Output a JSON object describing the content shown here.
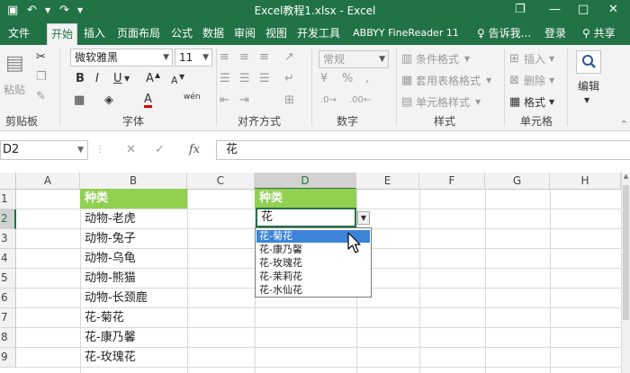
{
  "titlebar": {
    "title": "Excel教程1.xlsx - Excel",
    "undo_glyph": "↶",
    "redo_glyph": "↷",
    "save_glyph": "▣",
    "restore_glyph": "❐",
    "min_glyph": "—",
    "maximize_glyph": "□",
    "close_glyph": "✕"
  },
  "tabs": [
    {
      "label": "文件"
    },
    {
      "label": "开始",
      "active": true
    },
    {
      "label": "插入"
    },
    {
      "label": "页面布局"
    },
    {
      "label": "公式"
    },
    {
      "label": "数据"
    },
    {
      "label": "审阅"
    },
    {
      "label": "视图"
    },
    {
      "label": "开发工具"
    },
    {
      "label": "ABBYY FineReader 11"
    }
  ],
  "tell_me": "告诉我...",
  "login": "登录",
  "share": "共享",
  "ribbon": {
    "clipboard": {
      "paste": "粘贴",
      "label": "剪贴板"
    },
    "font": {
      "name": "微软雅黑",
      "size": "11",
      "bold": "B",
      "italic": "I",
      "underline": "U",
      "phonetic": "wén",
      "grow": "A",
      "shrink": "A",
      "font_color": "A",
      "label": "字体"
    },
    "alignment": {
      "label": "对齐方式"
    },
    "number": {
      "format": "常规",
      "label": "数字"
    },
    "styles": {
      "conditional": "条件格式",
      "table": "套用表格格式",
      "cell_styles": "单元格样式",
      "label": "样式"
    },
    "cells": {
      "insert": "插入",
      "delete": "删除",
      "format": "格式",
      "label": "单元格"
    },
    "editing": {
      "label": "编辑"
    }
  },
  "formula_bar": {
    "name_box": "D2",
    "formula": "花"
  },
  "grid": {
    "columns": [
      "A",
      "B",
      "C",
      "D",
      "E",
      "F",
      "G",
      "H"
    ],
    "rows": [
      "1",
      "2",
      "3",
      "4",
      "5",
      "6",
      "7",
      "8",
      "9"
    ],
    "selected_column": "D",
    "selected_row": "2",
    "col_b": [
      "种类",
      "动物-老虎",
      "动物-兔子",
      "动物-乌龟",
      "动物-熊猫",
      "动物-长颈鹿",
      "花-菊花",
      "花-康乃馨",
      "花-玫瑰花"
    ],
    "d1": "种类",
    "d2": "花",
    "header_color": "#92d050"
  },
  "dropdown": {
    "items": [
      "花-菊花",
      "花-康乃馨",
      "花-玫瑰花",
      "花-茉莉花",
      "花-水仙花"
    ],
    "highlighted_index": 0
  },
  "colors": {
    "accent": "#217346",
    "highlight": "#3b84d8"
  }
}
